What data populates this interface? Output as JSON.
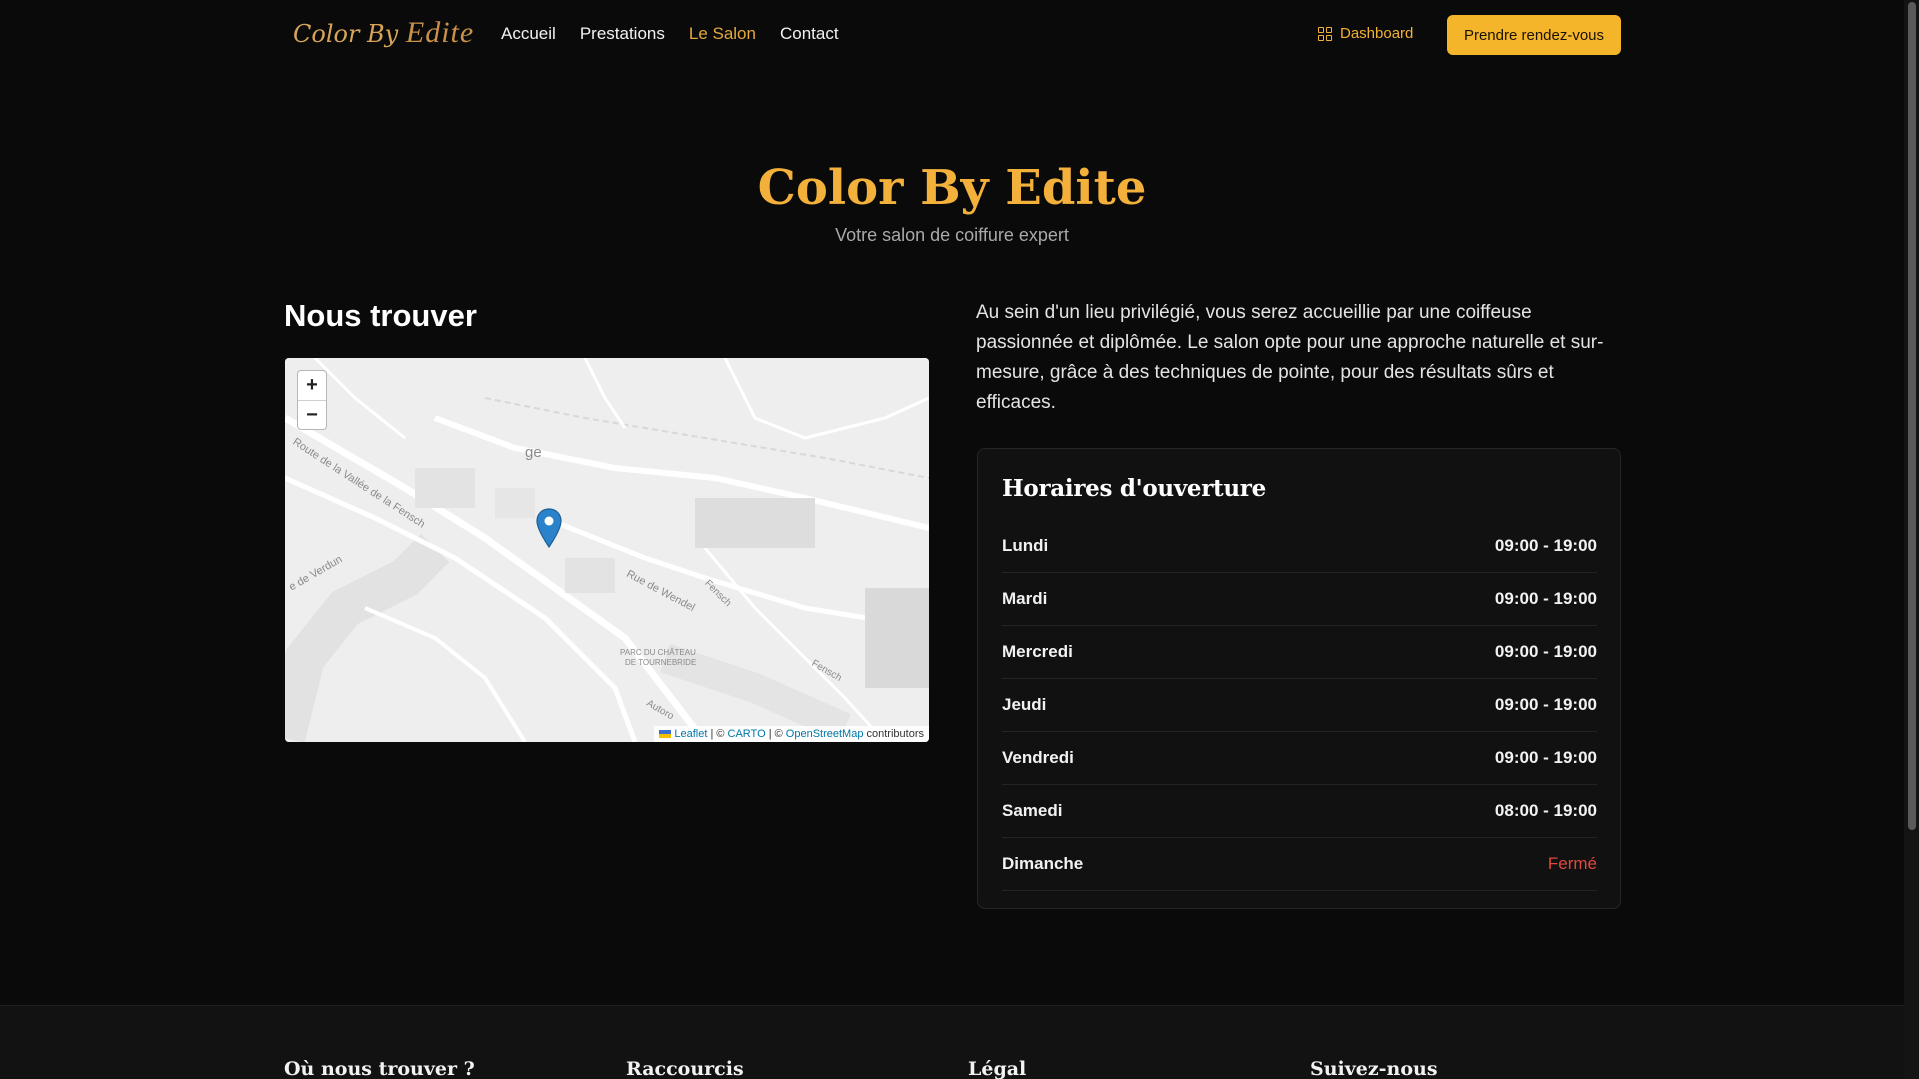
{
  "header": {
    "logo_part1": "Color By",
    "logo_part2": "Edite",
    "nav": [
      {
        "label": "Accueil",
        "active": false
      },
      {
        "label": "Prestations",
        "active": false
      },
      {
        "label": "Le Salon",
        "active": true
      },
      {
        "label": "Contact",
        "active": false
      }
    ],
    "dashboard_label": "Dashboard",
    "cta_label": "Prendre rendez-vous"
  },
  "hero": {
    "title": "Color By Edite",
    "subtitle": "Votre salon de coiffure expert"
  },
  "find_us": {
    "title": "Nous trouver",
    "map": {
      "zoom_in": "+",
      "zoom_out": "−",
      "labels": {
        "place_fragment": "ge",
        "road1": "Route de la Vallée de la Fensch",
        "road2": "Rue de Wendel",
        "road3": "e de Verdun",
        "park": "PARC DU CHÂTEAU",
        "park2": "DE TOURNEBRIDE",
        "river1": "Fensch",
        "river2": "Fensch",
        "highway": "Autoro"
      },
      "attribution": {
        "leaflet": "Leaflet",
        "sep1": "| ©",
        "carto": "CARTO",
        "sep2": "| ©",
        "osm": "OpenStreetMap",
        "contributors": "contributors"
      }
    }
  },
  "intro_text": "Au sein d'un lieu privilégié, vous serez accueillie par une coiffeuse passionnée et diplômée. Le salon opte pour une approche naturelle et sur-mesure, grâce à des techniques de pointe, pour des résultats sûrs et efficaces.",
  "hours": {
    "title": "Horaires d'ouverture",
    "rows": [
      {
        "day": "Lundi",
        "time": "09:00 - 19:00"
      },
      {
        "day": "Mardi",
        "time": "09:00 - 19:00"
      },
      {
        "day": "Mercredi",
        "time": "09:00 - 19:00"
      },
      {
        "day": "Jeudi",
        "time": "09:00 - 19:00"
      },
      {
        "day": "Vendredi",
        "time": "09:00 - 19:00"
      },
      {
        "day": "Samedi",
        "time": "08:00 - 19:00"
      },
      {
        "day": "Dimanche",
        "time": "Fermé"
      }
    ],
    "closed_color": "#e2483d"
  },
  "footer": {
    "col1": "Où nous trouver ?",
    "col2": "Raccourcis",
    "col3": "Légal",
    "col4": "Suivez-nous"
  },
  "colors": {
    "accent": "#f5b52b",
    "background": "#0a0a0a"
  }
}
